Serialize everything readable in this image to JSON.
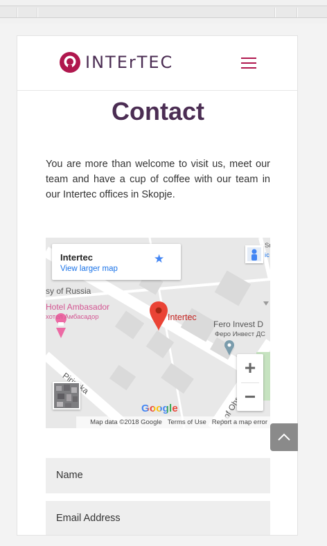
{
  "header": {
    "logo_text": "INTErTEC",
    "brand_color": "#b0174e",
    "title_color": "#4b2d53"
  },
  "page": {
    "title": "Contact",
    "intro": "You are more than welcome to visit us, meet our team and have a cup of coffee with our team in our Intertec offices in Skopje."
  },
  "map": {
    "place_title": "Intertec",
    "view_larger": "View larger map",
    "marker_label": "Intertec",
    "labels": {
      "russia": "sy of Russia",
      "hotel": "Hotel Ambasador",
      "hotel_cyr": "хотел Амбасадор",
      "fero": "Fero Invest D",
      "fero_cyr": "Феро Инвест ДС",
      "pirinska": "Pirinska",
      "ohr": "t of Ohr",
      "corner_top": "Sna",
      "corner_top2": "ic"
    },
    "zoom_in": "+",
    "zoom_out": "−",
    "google": "Google",
    "attribution": {
      "map_data": "Map data ©2018 Google",
      "terms": "Terms of Use",
      "report": "Report a map error"
    }
  },
  "form": {
    "name_placeholder": "Name",
    "email_placeholder": "Email Address"
  }
}
